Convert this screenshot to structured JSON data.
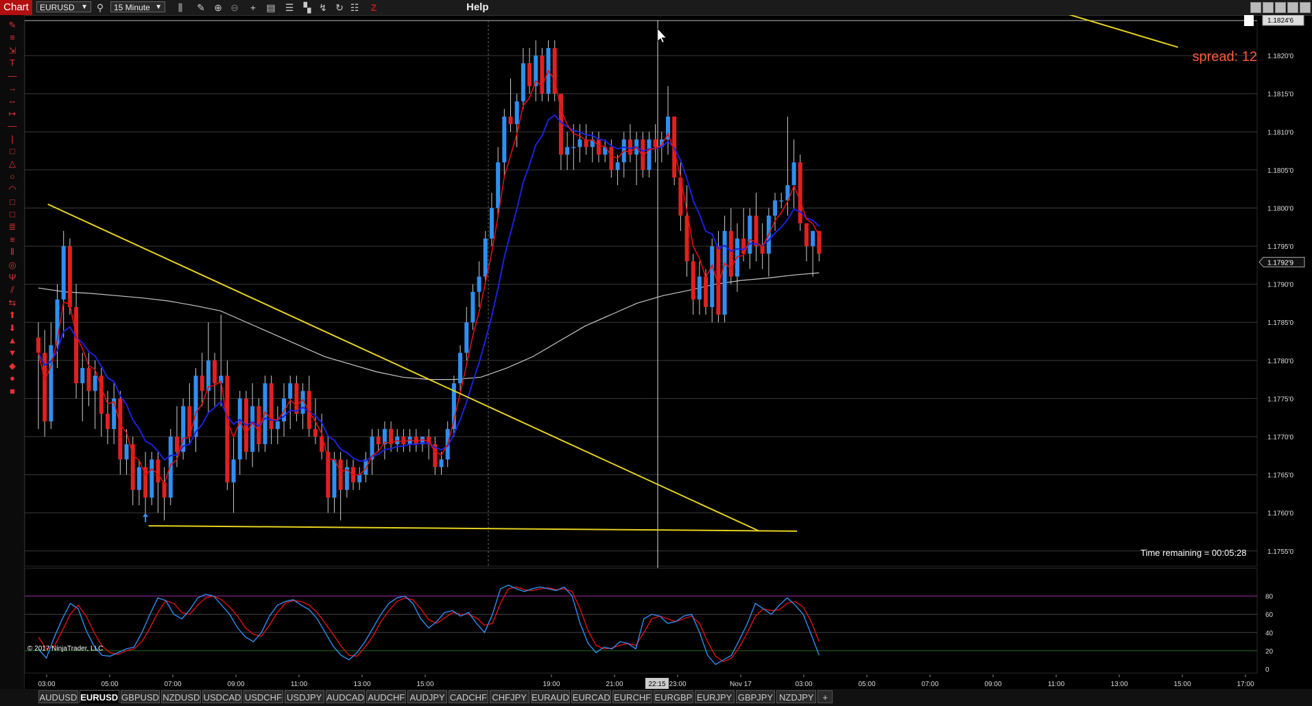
{
  "window": {
    "title": "Chart",
    "help_label": "Help"
  },
  "toolbar": {
    "instrument": "EURUSD",
    "interval": "15 Minute",
    "icons": [
      "search-icon",
      "bars-type-icon",
      "draw-pencil-icon",
      "zoom-in-icon",
      "zoom-out-icon",
      "crosshair-icon",
      "data-box-icon",
      "indicators-icon",
      "strategies-icon",
      "trend-icon",
      "reload-icon",
      "properties-icon",
      "z-order-icon"
    ]
  },
  "drawing_tools": [
    "pencil",
    "horizontal-lines",
    "ruler",
    "text",
    "line",
    "ray",
    "extended-line",
    "arrow-line",
    "horizontal-line",
    "vertical-line",
    "rectangle",
    "triangle",
    "ellipse",
    "arc",
    "square",
    "square-2",
    "fibonacci",
    "andrews-pitchfork",
    "gann-fan",
    "regression",
    "gann-wheel",
    "time-cycle",
    "risk-reward",
    "arrow-up",
    "arrow-down",
    "triangle-up",
    "triangle-down",
    "diamond",
    "dot",
    "square-marker"
  ],
  "price_axis": {
    "ticks": [
      "1.1820'0",
      "1.1815'0",
      "1.1810'0",
      "1.1805'0",
      "1.1800'0",
      "1.1795'0",
      "1.1790'0",
      "1.1785'0",
      "1.1780'0",
      "1.1775'0",
      "1.1770'0",
      "1.1765'0",
      "1.1760'0",
      "1.1755'0"
    ],
    "top_marker": "1.1824'6",
    "last_price": "1.1792'9"
  },
  "time_axis": {
    "ticks": [
      "03:00",
      "05:00",
      "07:00",
      "09:00",
      "11:00",
      "13:00",
      "15:00",
      "19:00",
      "21:00",
      "23:00",
      "Nov 17",
      "03:00",
      "05:00",
      "07:00",
      "09:00",
      "11:00",
      "13:00",
      "15:00",
      "17:00"
    ],
    "cursor_label": "22:15"
  },
  "osc_axis": {
    "ticks": [
      "80",
      "60",
      "40",
      "20",
      "0"
    ]
  },
  "overlay": {
    "spread": "spread: 12",
    "time_remaining": "Time remaining = 00:05:28",
    "copyright": "© 2017 NinjaTrader, LLC"
  },
  "tabs": [
    "AUDUSD",
    "EURUSD",
    "GBPUSD",
    "NZDUSD",
    "USDCAD",
    "USDCHF",
    "USDJPY",
    "AUDCAD",
    "AUDCHF",
    "AUDJPY",
    "CADCHF",
    "CHFJPY",
    "EURAUD",
    "EURCAD",
    "EURCHF",
    "EURGBP",
    "EURJPY",
    "GBPJPY",
    "NZDJPY"
  ],
  "active_tab": "EURUSD",
  "colors": {
    "up": "#2f8ff0",
    "down": "#e02020",
    "ema_fast": "#e01010",
    "ema_mid": "#1a22e0",
    "sma_slow": "#c8c8c8",
    "trendline": "#e6d21e",
    "stoch_k": "#2f8ff0",
    "stoch_d": "#e01010",
    "accent": "#b01010"
  },
  "chart_data": {
    "type": "candlestick",
    "instrument": "EURUSD",
    "interval": "15 Minute",
    "ylim": [
      1.1753,
      1.18246
    ],
    "candles": [
      {
        "o": 1.1783,
        "h": 1.1785,
        "l": 1.1771,
        "c": 1.1781
      },
      {
        "o": 1.1781,
        "h": 1.1784,
        "l": 1.177,
        "c": 1.1772
      },
      {
        "o": 1.1772,
        "h": 1.1785,
        "l": 1.1771,
        "c": 1.1782
      },
      {
        "o": 1.1782,
        "h": 1.179,
        "l": 1.1779,
        "c": 1.1788
      },
      {
        "o": 1.1788,
        "h": 1.1797,
        "l": 1.1783,
        "c": 1.1795
      },
      {
        "o": 1.1795,
        "h": 1.1796,
        "l": 1.1786,
        "c": 1.1787
      },
      {
        "o": 1.1787,
        "h": 1.179,
        "l": 1.1775,
        "c": 1.1777
      },
      {
        "o": 1.1777,
        "h": 1.1781,
        "l": 1.1772,
        "c": 1.1779
      },
      {
        "o": 1.1779,
        "h": 1.1781,
        "l": 1.1774,
        "c": 1.1776
      },
      {
        "o": 1.1776,
        "h": 1.178,
        "l": 1.1771,
        "c": 1.1778
      },
      {
        "o": 1.1778,
        "h": 1.1779,
        "l": 1.177,
        "c": 1.1773
      },
      {
        "o": 1.1773,
        "h": 1.1776,
        "l": 1.1769,
        "c": 1.1771
      },
      {
        "o": 1.1771,
        "h": 1.1777,
        "l": 1.1769,
        "c": 1.1775
      },
      {
        "o": 1.1775,
        "h": 1.1776,
        "l": 1.1765,
        "c": 1.1767
      },
      {
        "o": 1.1767,
        "h": 1.1771,
        "l": 1.1765,
        "c": 1.1769
      },
      {
        "o": 1.1769,
        "h": 1.177,
        "l": 1.1761,
        "c": 1.1763
      },
      {
        "o": 1.1763,
        "h": 1.1767,
        "l": 1.1761,
        "c": 1.1766
      },
      {
        "o": 1.1766,
        "h": 1.1768,
        "l": 1.1759,
        "c": 1.1762
      },
      {
        "o": 1.1762,
        "h": 1.1768,
        "l": 1.1761,
        "c": 1.1767
      },
      {
        "o": 1.1767,
        "h": 1.1768,
        "l": 1.176,
        "c": 1.1764
      },
      {
        "o": 1.1764,
        "h": 1.1766,
        "l": 1.1759,
        "c": 1.1762
      },
      {
        "o": 1.1762,
        "h": 1.1771,
        "l": 1.1761,
        "c": 1.177
      },
      {
        "o": 1.177,
        "h": 1.1774,
        "l": 1.1766,
        "c": 1.1768
      },
      {
        "o": 1.1768,
        "h": 1.1775,
        "l": 1.1767,
        "c": 1.1774
      },
      {
        "o": 1.1774,
        "h": 1.1777,
        "l": 1.1769,
        "c": 1.177
      },
      {
        "o": 1.177,
        "h": 1.1779,
        "l": 1.1768,
        "c": 1.1778
      },
      {
        "o": 1.1778,
        "h": 1.1781,
        "l": 1.1774,
        "c": 1.1776
      },
      {
        "o": 1.1776,
        "h": 1.1785,
        "l": 1.1773,
        "c": 1.178
      },
      {
        "o": 1.178,
        "h": 1.1781,
        "l": 1.1774,
        "c": 1.1777
      },
      {
        "o": 1.1777,
        "h": 1.1786,
        "l": 1.1774,
        "c": 1.1778
      },
      {
        "o": 1.1778,
        "h": 1.178,
        "l": 1.1763,
        "c": 1.1764
      },
      {
        "o": 1.1764,
        "h": 1.177,
        "l": 1.176,
        "c": 1.1767
      },
      {
        "o": 1.1767,
        "h": 1.1776,
        "l": 1.1765,
        "c": 1.1775
      },
      {
        "o": 1.1775,
        "h": 1.1776,
        "l": 1.1767,
        "c": 1.1768
      },
      {
        "o": 1.1768,
        "h": 1.1777,
        "l": 1.1766,
        "c": 1.1774
      },
      {
        "o": 1.1774,
        "h": 1.1775,
        "l": 1.1768,
        "c": 1.1769
      },
      {
        "o": 1.1769,
        "h": 1.1778,
        "l": 1.1768,
        "c": 1.1777
      },
      {
        "o": 1.1777,
        "h": 1.1778,
        "l": 1.1769,
        "c": 1.1771
      },
      {
        "o": 1.1771,
        "h": 1.1774,
        "l": 1.1769,
        "c": 1.1772
      },
      {
        "o": 1.1772,
        "h": 1.1777,
        "l": 1.177,
        "c": 1.1775
      },
      {
        "o": 1.1775,
        "h": 1.1778,
        "l": 1.1771,
        "c": 1.1777
      },
      {
        "o": 1.1777,
        "h": 1.1778,
        "l": 1.1772,
        "c": 1.1773
      },
      {
        "o": 1.1773,
        "h": 1.1777,
        "l": 1.1771,
        "c": 1.1776
      },
      {
        "o": 1.1776,
        "h": 1.1778,
        "l": 1.177,
        "c": 1.1771
      },
      {
        "o": 1.1771,
        "h": 1.1775,
        "l": 1.1769,
        "c": 1.177
      },
      {
        "o": 1.177,
        "h": 1.1773,
        "l": 1.1767,
        "c": 1.1768
      },
      {
        "o": 1.1768,
        "h": 1.177,
        "l": 1.176,
        "c": 1.1762
      },
      {
        "o": 1.1762,
        "h": 1.1768,
        "l": 1.176,
        "c": 1.1767
      },
      {
        "o": 1.1767,
        "h": 1.1768,
        "l": 1.1759,
        "c": 1.1763
      },
      {
        "o": 1.1763,
        "h": 1.1767,
        "l": 1.1762,
        "c": 1.1766
      },
      {
        "o": 1.1766,
        "h": 1.1767,
        "l": 1.1763,
        "c": 1.1764
      },
      {
        "o": 1.1764,
        "h": 1.1766,
        "l": 1.1763,
        "c": 1.1765
      },
      {
        "o": 1.1765,
        "h": 1.1768,
        "l": 1.1764,
        "c": 1.1767
      },
      {
        "o": 1.1767,
        "h": 1.1771,
        "l": 1.1765,
        "c": 1.177
      },
      {
        "o": 1.177,
        "h": 1.1771,
        "l": 1.1768,
        "c": 1.1769
      },
      {
        "o": 1.1769,
        "h": 1.1772,
        "l": 1.1767,
        "c": 1.1771
      },
      {
        "o": 1.1771,
        "h": 1.1772,
        "l": 1.1768,
        "c": 1.1769
      },
      {
        "o": 1.1769,
        "h": 1.1771,
        "l": 1.1768,
        "c": 1.177
      },
      {
        "o": 1.177,
        "h": 1.1771,
        "l": 1.1768,
        "c": 1.1769
      },
      {
        "o": 1.1769,
        "h": 1.1771,
        "l": 1.1768,
        "c": 1.177
      },
      {
        "o": 1.177,
        "h": 1.1771,
        "l": 1.1768,
        "c": 1.1769
      },
      {
        "o": 1.1769,
        "h": 1.177,
        "l": 1.1768,
        "c": 1.177
      },
      {
        "o": 1.177,
        "h": 1.1771,
        "l": 1.1767,
        "c": 1.1769
      },
      {
        "o": 1.1769,
        "h": 1.177,
        "l": 1.1765,
        "c": 1.1766
      },
      {
        "o": 1.1766,
        "h": 1.1768,
        "l": 1.1765,
        "c": 1.1767
      },
      {
        "o": 1.1767,
        "h": 1.1772,
        "l": 1.1766,
        "c": 1.1771
      },
      {
        "o": 1.1771,
        "h": 1.1778,
        "l": 1.177,
        "c": 1.1777
      },
      {
        "o": 1.1777,
        "h": 1.1782,
        "l": 1.1776,
        "c": 1.1781
      },
      {
        "o": 1.1781,
        "h": 1.1787,
        "l": 1.178,
        "c": 1.1785
      },
      {
        "o": 1.1785,
        "h": 1.179,
        "l": 1.1784,
        "c": 1.1789
      },
      {
        "o": 1.1789,
        "h": 1.1793,
        "l": 1.1787,
        "c": 1.1791
      },
      {
        "o": 1.1791,
        "h": 1.1797,
        "l": 1.179,
        "c": 1.1796
      },
      {
        "o": 1.1796,
        "h": 1.1802,
        "l": 1.1795,
        "c": 1.18
      },
      {
        "o": 1.18,
        "h": 1.1808,
        "l": 1.1799,
        "c": 1.1806
      },
      {
        "o": 1.1806,
        "h": 1.1813,
        "l": 1.1804,
        "c": 1.1812
      },
      {
        "o": 1.1812,
        "h": 1.1817,
        "l": 1.181,
        "c": 1.1811
      },
      {
        "o": 1.1811,
        "h": 1.1815,
        "l": 1.1808,
        "c": 1.1814
      },
      {
        "o": 1.1814,
        "h": 1.1821,
        "l": 1.1813,
        "c": 1.1819
      },
      {
        "o": 1.1819,
        "h": 1.1821,
        "l": 1.1815,
        "c": 1.1816
      },
      {
        "o": 1.1816,
        "h": 1.1822,
        "l": 1.1814,
        "c": 1.182
      },
      {
        "o": 1.182,
        "h": 1.1821,
        "l": 1.1814,
        "c": 1.1815
      },
      {
        "o": 1.1815,
        "h": 1.1822,
        "l": 1.1814,
        "c": 1.1821
      },
      {
        "o": 1.1821,
        "h": 1.1822,
        "l": 1.1814,
        "c": 1.1815
      },
      {
        "o": 1.1815,
        "h": 1.1815,
        "l": 1.1805,
        "c": 1.1807
      },
      {
        "o": 1.1807,
        "h": 1.181,
        "l": 1.1805,
        "c": 1.1808
      },
      {
        "o": 1.1808,
        "h": 1.1811,
        "l": 1.1805,
        "c": 1.1808
      },
      {
        "o": 1.1808,
        "h": 1.1811,
        "l": 1.1806,
        "c": 1.1809
      },
      {
        "o": 1.1809,
        "h": 1.1811,
        "l": 1.1807,
        "c": 1.1808
      },
      {
        "o": 1.1808,
        "h": 1.181,
        "l": 1.1806,
        "c": 1.1809
      },
      {
        "o": 1.1809,
        "h": 1.181,
        "l": 1.1806,
        "c": 1.1807
      },
      {
        "o": 1.1807,
        "h": 1.1809,
        "l": 1.1806,
        "c": 1.1808
      },
      {
        "o": 1.1808,
        "h": 1.1809,
        "l": 1.1804,
        "c": 1.1805
      },
      {
        "o": 1.1805,
        "h": 1.1807,
        "l": 1.1803,
        "c": 1.1806
      },
      {
        "o": 1.1806,
        "h": 1.181,
        "l": 1.1804,
        "c": 1.1809
      },
      {
        "o": 1.1809,
        "h": 1.1811,
        "l": 1.1806,
        "c": 1.1807
      },
      {
        "o": 1.1807,
        "h": 1.181,
        "l": 1.1803,
        "c": 1.1809
      },
      {
        "o": 1.1809,
        "h": 1.181,
        "l": 1.1804,
        "c": 1.1805
      },
      {
        "o": 1.1805,
        "h": 1.181,
        "l": 1.1804,
        "c": 1.1809
      },
      {
        "o": 1.1809,
        "h": 1.1811,
        "l": 1.1806,
        "c": 1.1808
      },
      {
        "o": 1.1808,
        "h": 1.181,
        "l": 1.1806,
        "c": 1.1809
      },
      {
        "o": 1.1809,
        "h": 1.1816,
        "l": 1.1807,
        "c": 1.1812
      },
      {
        "o": 1.1812,
        "h": 1.1812,
        "l": 1.1803,
        "c": 1.1804
      },
      {
        "o": 1.1804,
        "h": 1.1806,
        "l": 1.1797,
        "c": 1.1799
      },
      {
        "o": 1.1799,
        "h": 1.1803,
        "l": 1.1791,
        "c": 1.1793
      },
      {
        "o": 1.1793,
        "h": 1.1794,
        "l": 1.1786,
        "c": 1.1788
      },
      {
        "o": 1.1788,
        "h": 1.1793,
        "l": 1.1786,
        "c": 1.1791
      },
      {
        "o": 1.1791,
        "h": 1.1792,
        "l": 1.1786,
        "c": 1.1787
      },
      {
        "o": 1.1787,
        "h": 1.1796,
        "l": 1.1785,
        "c": 1.1795
      },
      {
        "o": 1.1795,
        "h": 1.1797,
        "l": 1.1785,
        "c": 1.1786
      },
      {
        "o": 1.1786,
        "h": 1.1799,
        "l": 1.1785,
        "c": 1.1797
      },
      {
        "o": 1.1797,
        "h": 1.18,
        "l": 1.179,
        "c": 1.1791
      },
      {
        "o": 1.1791,
        "h": 1.1798,
        "l": 1.1789,
        "c": 1.1796
      },
      {
        "o": 1.1796,
        "h": 1.18,
        "l": 1.1793,
        "c": 1.1794
      },
      {
        "o": 1.1794,
        "h": 1.18,
        "l": 1.1792,
        "c": 1.1799
      },
      {
        "o": 1.1799,
        "h": 1.1802,
        "l": 1.1793,
        "c": 1.1795
      },
      {
        "o": 1.1795,
        "h": 1.1798,
        "l": 1.1792,
        "c": 1.1794
      },
      {
        "o": 1.1794,
        "h": 1.18,
        "l": 1.1791,
        "c": 1.1799
      },
      {
        "o": 1.1799,
        "h": 1.1802,
        "l": 1.1797,
        "c": 1.1801
      },
      {
        "o": 1.1801,
        "h": 1.1802,
        "l": 1.18,
        "c": 1.1801
      },
      {
        "o": 1.1801,
        "h": 1.1812,
        "l": 1.1799,
        "c": 1.1803
      },
      {
        "o": 1.1803,
        "h": 1.1809,
        "l": 1.18,
        "c": 1.1806
      },
      {
        "o": 1.1806,
        "h": 1.1807,
        "l": 1.1797,
        "c": 1.1798
      },
      {
        "o": 1.1798,
        "h": 1.1798,
        "l": 1.1793,
        "c": 1.1795
      },
      {
        "o": 1.1795,
        "h": 1.1797,
        "l": 1.1791,
        "c": 1.1797
      },
      {
        "o": 1.1797,
        "h": 1.1797,
        "l": 1.1793,
        "c": 1.1794
      }
    ],
    "sma_slow": [
      1.17895,
      1.1789,
      1.17888,
      1.17885,
      1.17882,
      1.17878,
      1.17872,
      1.17865,
      1.1785,
      1.17835,
      1.1782,
      1.17805,
      1.17795,
      1.17785,
      1.17778,
      1.17775,
      1.17775,
      1.17778,
      1.1779,
      1.17805,
      1.17825,
      1.17845,
      1.1786,
      1.17875,
      1.17885,
      1.17892,
      1.179,
      1.17905,
      1.17908,
      1.17912,
      1.17915
    ],
    "trendlines": [
      {
        "x1": 1.5,
        "y1": 1.18005,
        "x2": 114.5,
        "y2": 1.17576
      },
      {
        "x1": 17.5,
        "y1": 1.17583,
        "x2": 120.5,
        "y2": 1.17576
      },
      {
        "x1": 158,
        "y1": 1.18268,
        "x2": 181,
        "y2": 1.18211
      }
    ],
    "stochastics": {
      "ylim": [
        0,
        100
      ],
      "levels": [
        80,
        60,
        40,
        20
      ],
      "k": [
        22,
        12,
        35,
        55,
        72,
        66,
        42,
        25,
        15,
        14,
        18,
        22,
        24,
        40,
        60,
        78,
        75,
        60,
        55,
        65,
        78,
        82,
        80,
        70,
        60,
        45,
        35,
        30,
        40,
        58,
        70,
        74,
        76,
        70,
        65,
        55,
        40,
        25,
        15,
        10,
        18,
        30,
        45,
        60,
        72,
        78,
        80,
        72,
        55,
        45,
        52,
        62,
        64,
        58,
        62,
        50,
        40,
        60,
        88,
        92,
        88,
        85,
        88,
        90,
        88,
        86,
        90,
        80,
        50,
        28,
        18,
        24,
        22,
        30,
        28,
        22,
        55,
        60,
        58,
        50,
        52,
        58,
        60,
        40,
        15,
        5,
        10,
        15,
        32,
        50,
        72,
        66,
        60,
        70,
        78,
        70,
        60,
        38,
        15
      ],
      "d": [
        35,
        22,
        25,
        42,
        60,
        70,
        58,
        40,
        25,
        18,
        16,
        20,
        22,
        30,
        45,
        62,
        75,
        72,
        62,
        60,
        70,
        78,
        80,
        76,
        68,
        58,
        45,
        38,
        36,
        48,
        62,
        72,
        75,
        74,
        70,
        62,
        50,
        38,
        25,
        15,
        14,
        24,
        36,
        52,
        64,
        74,
        78,
        76,
        66,
        54,
        50,
        56,
        62,
        60,
        60,
        56,
        48,
        50,
        72,
        88,
        90,
        87,
        86,
        88,
        89,
        87,
        88,
        85,
        66,
        42,
        26,
        22,
        23,
        26,
        28,
        26,
        40,
        55,
        58,
        55,
        52,
        55,
        58,
        50,
        30,
        14,
        8,
        12,
        24,
        40,
        58,
        66,
        64,
        65,
        72,
        74,
        68,
        52,
        30
      ]
    }
  }
}
